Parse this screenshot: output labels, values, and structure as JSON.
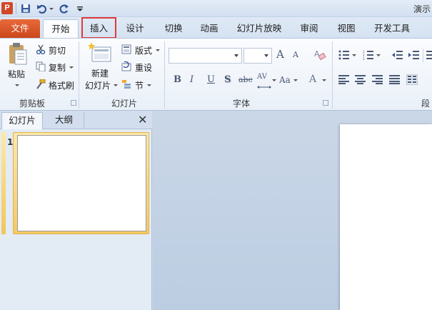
{
  "window": {
    "title": "演示",
    "app_logo": "P"
  },
  "quick_access": {
    "icons": [
      "save-icon",
      "undo-icon",
      "redo-icon",
      "customize-icon"
    ]
  },
  "tabs": [
    {
      "label": "文件"
    },
    {
      "label": "开始"
    },
    {
      "label": "插入"
    },
    {
      "label": "设计"
    },
    {
      "label": "切换"
    },
    {
      "label": "动画"
    },
    {
      "label": "幻灯片放映"
    },
    {
      "label": "审阅"
    },
    {
      "label": "视图"
    },
    {
      "label": "开发工具"
    }
  ],
  "ribbon": {
    "clipboard": {
      "paste": "粘贴",
      "cut": "剪切",
      "copy": "复制",
      "format_painter": "格式刷",
      "group_label": "剪贴板"
    },
    "slides": {
      "new_slide_line1": "新建",
      "new_slide_line2": "幻灯片",
      "layout": "版式",
      "reset": "重设",
      "section": "节",
      "group_label": "幻灯片"
    },
    "font": {
      "font_name": "",
      "font_size": "",
      "bold": "B",
      "italic": "I",
      "underline": "U",
      "shadow": "S",
      "strikethrough": "abc",
      "spacing": "AV",
      "change_case": "Aa",
      "font_color": "A",
      "grow": "A",
      "shrink": "A",
      "group_label": "字体"
    },
    "paragraph": {
      "group_label": "段"
    }
  },
  "left_pane": {
    "tab_slides": "幻灯片",
    "tab_outline": "大纲",
    "close": "✕",
    "slide_number": "1"
  },
  "colors": {
    "file_tab": "#d24726",
    "highlight": "#e03a3a",
    "selected_thumb": "#f6c966"
  }
}
